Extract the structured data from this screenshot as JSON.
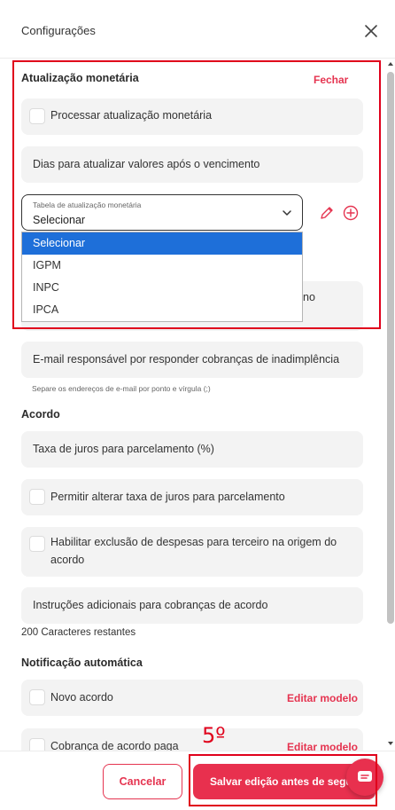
{
  "header": {
    "title": "Configurações"
  },
  "monetary": {
    "title": "Atualização monetária",
    "close_link": "Fechar",
    "process_label": "Processar atualização monetária",
    "days_label": "Dias para atualizar valores após o vencimento",
    "select": {
      "label": "Tabela de atualização monetária",
      "value": "Selecionar",
      "options": [
        "Selecionar",
        "IGPM",
        "INPC",
        "IPCA"
      ]
    },
    "hidden_field_tail": "no"
  },
  "delinquency": {
    "email_label": "E-mail responsável por responder cobranças de inadimplência",
    "email_helper": "Separe os endereços de e-mail por ponto e vírgula (;)"
  },
  "agreement": {
    "title": "Acordo",
    "interest_label": "Taxa de juros para parcelamento (%)",
    "allow_interest_label": "Permitir alterar taxa de juros para parcelamento",
    "exclusion_label_line1": "Habilitar exclusão de despesas para terceiro na origem do",
    "exclusion_label_line2": "acordo",
    "instructions_placeholder": "Instruções adicionais para cobranças de acordo",
    "chars_remaining": "200 Caracteres restantes"
  },
  "notification": {
    "title": "Notificação automática",
    "items": [
      {
        "label": "Novo acordo",
        "action": "Editar modelo"
      },
      {
        "label": "Cobrança de acordo paga",
        "action": "Editar modelo"
      }
    ]
  },
  "footer": {
    "cancel_label": "Cancelar",
    "save_label": "Salvar edição antes de seguir"
  },
  "annotation": {
    "step": "5º"
  },
  "colors": {
    "accent": "#e8304e",
    "highlight_border": "#e0001b",
    "option_selected": "#1e6fd9",
    "field_bg": "#f3f3f3"
  }
}
